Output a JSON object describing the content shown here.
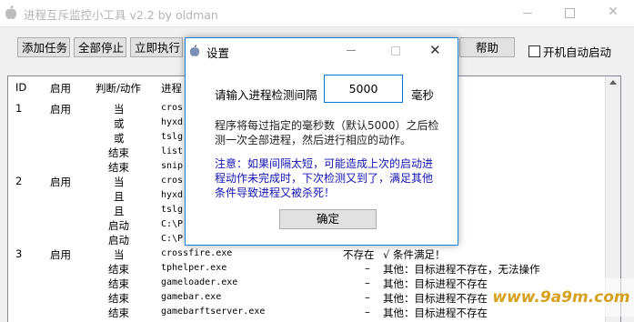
{
  "window": {
    "title": "进程互斥监控小工具 v2.2 by oldman",
    "minimize": "—",
    "maximize": "□",
    "close": "✕"
  },
  "toolbar": {
    "add_task": "添加任务",
    "stop_all": "全部停止",
    "run_now": "立即执行",
    "help": "帮助",
    "autostart_label": "开机自动启动",
    "autostart_checked": false
  },
  "list": {
    "columns": [
      "ID",
      "启用",
      "判断/动作",
      "进程"
    ],
    "rows": [
      {
        "id": "1",
        "enabled": "启用",
        "action": "当",
        "process": "cros",
        "status": "",
        "result": "：进程不存在"
      },
      {
        "id": "",
        "enabled": "",
        "action": "或",
        "process": "hyxd",
        "status": "",
        "result": "：进程不存在"
      },
      {
        "id": "",
        "enabled": "",
        "action": "或",
        "process": "tslg",
        "status": "",
        "result": "：进程不存在"
      },
      {
        "id": "",
        "enabled": "",
        "action": "结束",
        "process": "list",
        "status": "",
        "result": "满足，跳过执行"
      },
      {
        "id": "",
        "enabled": "",
        "action": "结束",
        "process": "snip",
        "status": "",
        "result": "足，跳过执行"
      },
      {
        "id": "2",
        "enabled": "启用",
        "action": "当",
        "process": "cros",
        "status": "",
        "result": ""
      },
      {
        "id": "",
        "enabled": "",
        "action": "且",
        "process": "hyxd",
        "status": "",
        "result": ""
      },
      {
        "id": "",
        "enabled": "",
        "action": "且",
        "process": "tslg",
        "status": "",
        "result": ""
      },
      {
        "id": "",
        "enabled": "",
        "action": "启动",
        "process": "C:\\P",
        "status": "",
        "result": "程失败！"
      },
      {
        "id": "",
        "enabled": "",
        "action": "启动",
        "process": "C:\\P",
        "status": "",
        "result": "程失败！"
      },
      {
        "id": "3",
        "enabled": "启用",
        "action": "当",
        "process": "crossfire.exe",
        "status": "不存在",
        "result": "√ 条件满足！"
      },
      {
        "id": "",
        "enabled": "",
        "action": "结束",
        "process": "tphelper.exe",
        "status": "–",
        "result": "其他：目标进程不存在，无法操作"
      },
      {
        "id": "",
        "enabled": "",
        "action": "结束",
        "process": "gameloader.exe",
        "status": "–",
        "result": "其他：目标进程不存在"
      },
      {
        "id": "",
        "enabled": "",
        "action": "结束",
        "process": "gamebar.exe",
        "status": "–",
        "result": "其他：目标进程不存在"
      },
      {
        "id": "",
        "enabled": "",
        "action": "结束",
        "process": "gamebarftserver.exe",
        "status": "–",
        "result": "其他：目标进程不存在"
      }
    ]
  },
  "dialog": {
    "title": "设置",
    "prompt": "请输入进程检测间隔",
    "interval_value": "5000",
    "unit": "毫秒",
    "description": "程序将每过指定的毫秒数（默认5000）之后检测一次全部进程，然后进行相应的动作。",
    "warning": "注意：如果间隔太短，可能造成上次的启动进程动作未完成时，下次检测又到了，满足其他条件导致进程又被杀死！",
    "ok": "确定"
  },
  "watermark": "www.9a9m.com"
}
